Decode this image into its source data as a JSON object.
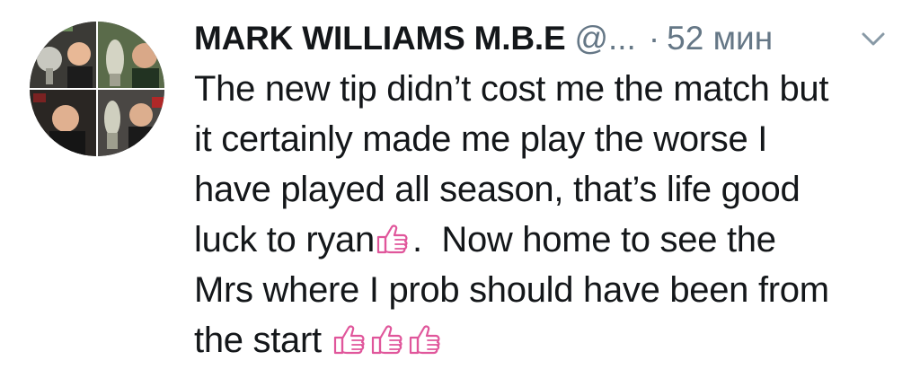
{
  "tweet": {
    "author": {
      "display_name": "MARK WILLIAMS M.B.E",
      "handle": "@...",
      "avatar_icon": "profile-photo-collage"
    },
    "separator": "·",
    "timestamp": "52 мин",
    "menu_icon": "chevron-down-icon",
    "text_lines": [
      [
        "The new tip didn’t cost me the match but"
      ],
      [
        "it certainly made me play the worse I"
      ],
      [
        "have played all season, that’s life good"
      ],
      [
        "luck to ryan",
        "thumbs-up-emoji",
        ".  Now home to see the"
      ],
      [
        "Mrs where I prob should have been from"
      ],
      [
        "the start ",
        "thumbs-up-emoji",
        "thumbs-up-emoji",
        "thumbs-up-emoji"
      ]
    ],
    "emoji_color": "#e0569b"
  },
  "colors": {
    "name": "#14171a",
    "meta": "#657786",
    "text": "#14171a"
  }
}
